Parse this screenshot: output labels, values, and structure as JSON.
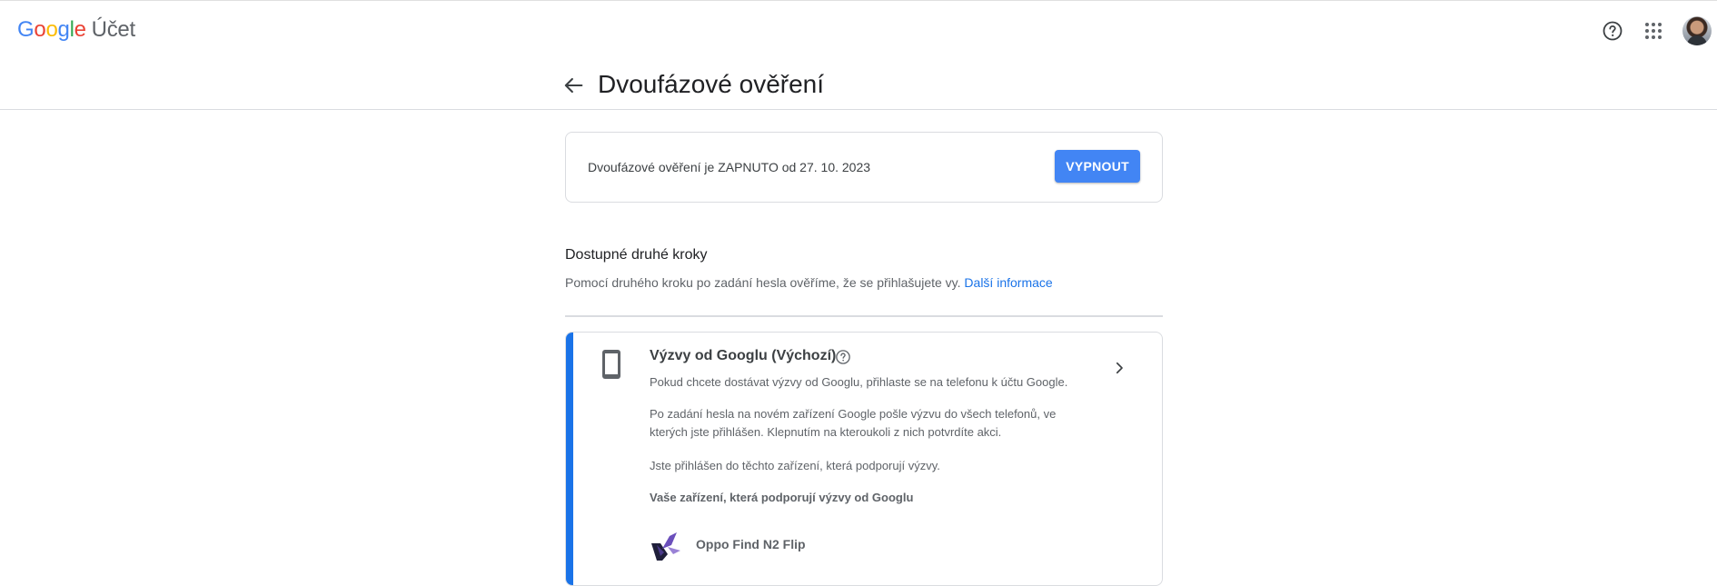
{
  "app": {
    "logo_letters": [
      "G",
      "o",
      "o",
      "g",
      "l",
      "e"
    ],
    "product": "Účet"
  },
  "header_icons": [
    "help-icon",
    "apps-icon",
    "avatar"
  ],
  "page": {
    "title": "Dvoufázové ověření"
  },
  "status": {
    "text": "Dvoufázové ověření je ZAPNUTO od 27. 10. 2023",
    "button_label": "VYPNOUT"
  },
  "second_steps": {
    "title": "Dostupné druhé kroky",
    "description": "Pomocí druhého kroku po zadání hesla ověříme, že se přihlašujete vy.",
    "more_link": "Další informace"
  },
  "prompt_card": {
    "title": "Výzvy od Googlu (Výchozí)",
    "p1": "Pokud chcete dostávat výzvy od Googlu, přihlaste se na telefonu k účtu Google.",
    "p2": "Po zadání hesla na novém zařízení Google pošle výzvu do všech telefonů, ve kterých jste přihlášen. Klepnutím na kteroukoli z nich potvrdíte akci.",
    "p3": "Jste přihlášen do těchto zařízení, která podporují výzvy.",
    "devices_heading": "Vaše zařízení, která podporují výzvy od Googlu",
    "device_name": "Oppo Find N2 Flip"
  },
  "colors": {
    "accent": "#1a73e8",
    "button": "#4285f4"
  }
}
